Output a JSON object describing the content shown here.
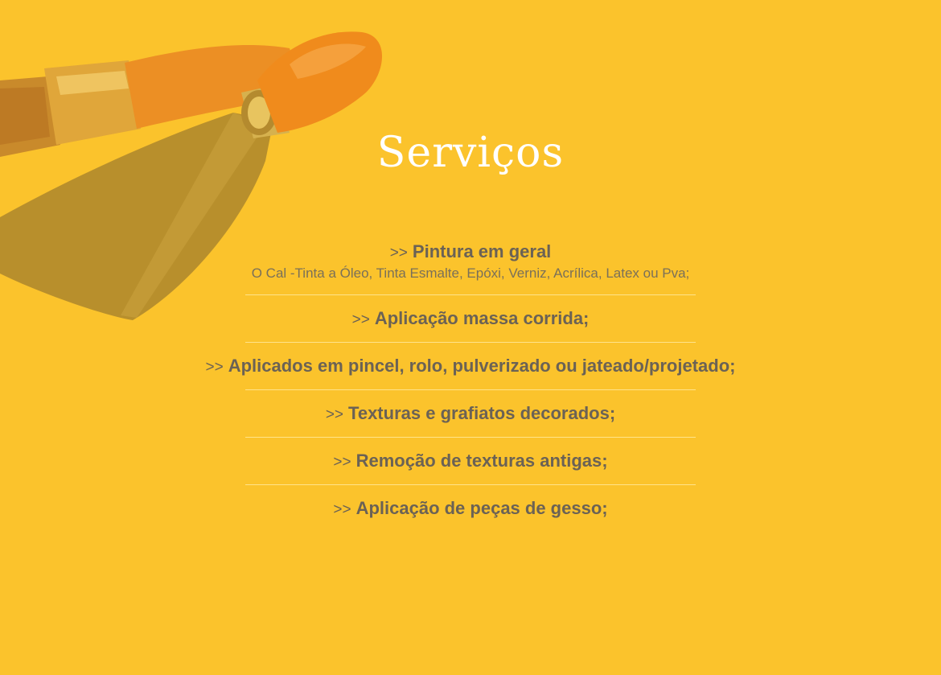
{
  "page": {
    "title": "Serviços",
    "background": "#fbc32c",
    "text_color": "#6b6255",
    "title_color": "#ffffff"
  },
  "hero_image": {
    "icon": "paint-brush-and-spatula-image"
  },
  "services": {
    "prefix": ">>",
    "items": [
      {
        "name": "Pintura em geral",
        "description": "O Cal -Tinta a Óleo, Tinta Esmalte, Epóxi, Verniz, Acrílica, Latex ou Pva;"
      },
      {
        "name": "Aplicação massa corrida;"
      },
      {
        "name": "Aplicados em pincel, rolo, pulverizado ou jateado/projetado;"
      },
      {
        "name": "Texturas e grafiatos decorados;"
      },
      {
        "name": "Remoção de texturas antigas;"
      },
      {
        "name": "Aplicação de peças de gesso;"
      }
    ]
  }
}
